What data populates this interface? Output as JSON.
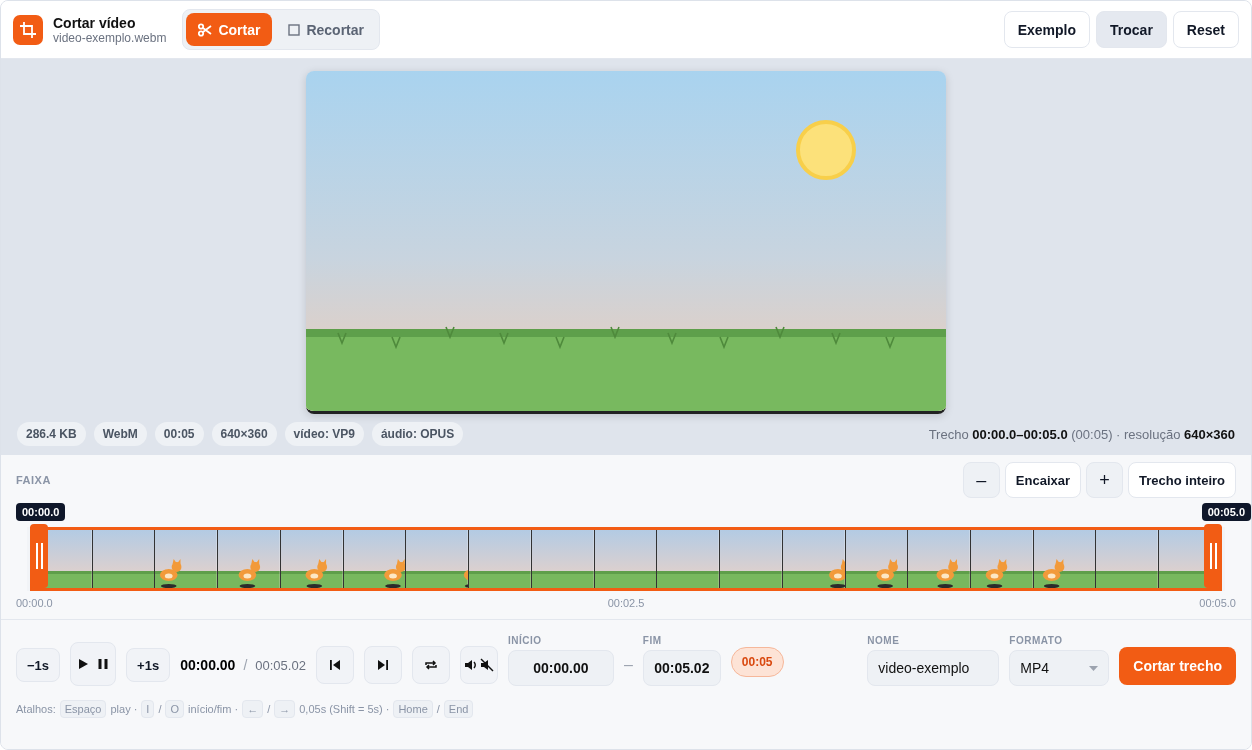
{
  "header": {
    "title": "Cortar vídeo",
    "filename": "video-exemplo.webm",
    "modes": [
      {
        "kind": "scissors",
        "label": "Cortar",
        "selected": true
      },
      {
        "kind": "square",
        "label": "Recortar",
        "selected": false
      }
    ],
    "actions": [
      {
        "label": "Exemplo",
        "selected": false
      },
      {
        "label": "Trocar",
        "selected": true
      },
      {
        "label": "Reset",
        "selected": false
      }
    ]
  },
  "file_tags": [
    "286.4 KB",
    "WebM",
    "00:05",
    "640×360",
    "vídeo: VP9",
    "áudio: OPUS"
  ],
  "selection_summary": "Trecho **00:00.0–00:05.0** (00:05) · resolução **640×360**",
  "timeline": {
    "title": "FAIXA",
    "zoom_buttons": [
      {
        "label": "–",
        "kind": "square"
      },
      {
        "label": "Encaixar",
        "kind": "wide"
      },
      {
        "label": "+",
        "kind": "square"
      },
      {
        "label": "Trecho inteiro",
        "kind": "wide"
      }
    ],
    "start_handle": {
      "label": "00:00.0"
    },
    "end_handle": {
      "label": "00:05.0"
    },
    "selection": {
      "level": 1
    },
    "ticks": [
      "00:00.0",
      "00:02.5",
      "00:05.0"
    ]
  },
  "controls": {
    "step_back": "−1s",
    "step_forward": "+1s",
    "current_time": "00:00.00",
    "separator": "/",
    "duration": "00:05.02",
    "start": {
      "label": "INÍCIO",
      "value": "00:00.00"
    },
    "range_dash": "–",
    "end": {
      "label": "FIM",
      "value": "00:05.02"
    },
    "length_badge": "00:05",
    "name": {
      "label": "NOME",
      "value": "video-exemplo"
    },
    "format": {
      "label": "FORMATO",
      "value": "MP4"
    },
    "submit": "Cortar trecho"
  },
  "shortcuts": [
    {
      "kind": "text",
      "text": "Atalhos:"
    },
    {
      "kind": "key",
      "text": "Espaço"
    },
    {
      "kind": "text",
      "text": "play ·"
    },
    {
      "kind": "key",
      "text": "I"
    },
    {
      "kind": "text",
      "text": "/"
    },
    {
      "kind": "key",
      "text": "O"
    },
    {
      "kind": "text",
      "text": "início/fim ·"
    },
    {
      "kind": "key",
      "text": "←"
    },
    {
      "kind": "text",
      "text": "/"
    },
    {
      "kind": "key",
      "text": "→"
    },
    {
      "kind": "text",
      "text": "0,05s (Shift = 5s) ·"
    },
    {
      "kind": "key",
      "text": "Home"
    },
    {
      "kind": "text",
      "text": "/"
    },
    {
      "kind": "key",
      "text": "End"
    }
  ]
}
